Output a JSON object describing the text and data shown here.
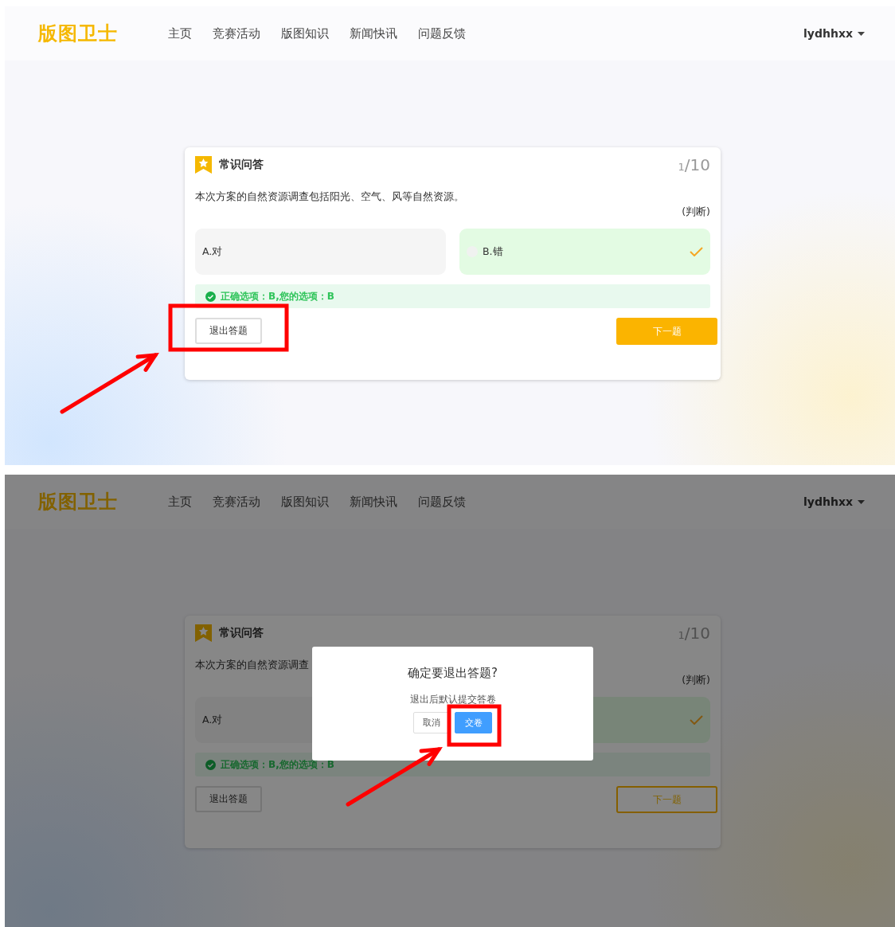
{
  "panels": [
    {
      "header": {
        "logo": "版图卫士",
        "nav": [
          {
            "label": "主页"
          },
          {
            "label": "竞赛活动"
          },
          {
            "label": "版图知识"
          },
          {
            "label": "新闻快讯"
          },
          {
            "label": "问题反馈"
          }
        ],
        "user": "lydhhxx"
      },
      "quiz": {
        "title": "常识问答",
        "counter": {
          "current": "1",
          "total": "/10"
        },
        "question": "本次方案的自然资源调查包括阳光、空气、风等自然资源。",
        "type": "(判断)",
        "options": [
          {
            "label": "A.对",
            "selected": false
          },
          {
            "label": "B.错",
            "selected": true
          }
        ],
        "result": "正确选项：B,您的选项：B",
        "exit_button": {
          "label": "退出答题",
          "highlighted": true
        },
        "next_button": {
          "label": "下一题",
          "filled": true
        }
      }
    },
    {
      "header": {
        "logo": "版图卫士",
        "nav": [
          {
            "label": "主页"
          },
          {
            "label": "竞赛活动"
          },
          {
            "label": "版图知识"
          },
          {
            "label": "新闻快讯"
          },
          {
            "label": "问题反馈"
          }
        ],
        "user": "lydhhxx"
      },
      "quiz": {
        "title": "常识问答",
        "counter": {
          "current": "1",
          "total": "/10"
        },
        "question": "本次方案的自然资源调查",
        "type": "(判断)",
        "options": [
          {
            "label": "A.对",
            "selected": false
          },
          {
            "selected": true
          }
        ],
        "result": "正确选项：B,您的选项：B",
        "exit_button": {
          "label": "退出答题"
        },
        "next_button": {
          "label": "下一题",
          "filled": false
        }
      },
      "dialog": {
        "title": "确定要退出答题?",
        "message": "退出后默认提交答卷",
        "buttons": [
          {
            "label": "取消",
            "kind": "secondary"
          },
          {
            "label": "交卷",
            "kind": "primary",
            "highlighted": true
          }
        ]
      }
    }
  ]
}
